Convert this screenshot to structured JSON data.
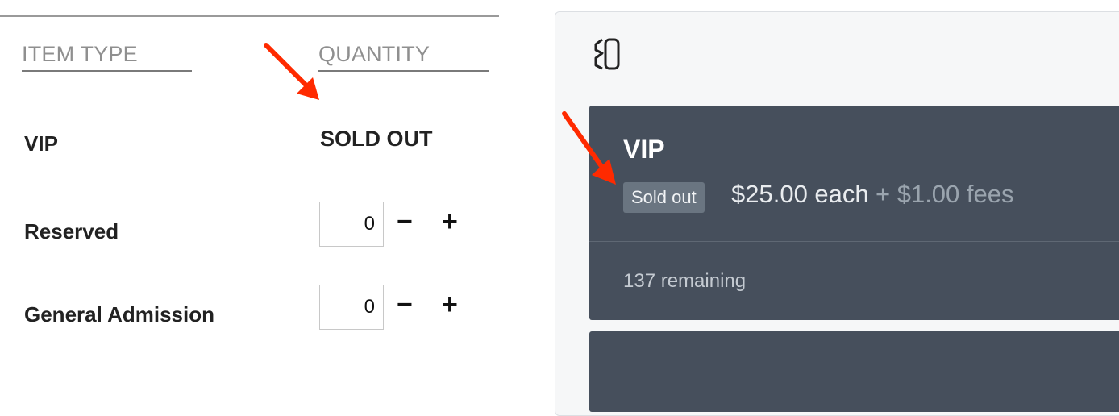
{
  "left_table": {
    "headers": {
      "item_type": "ITEM TYPE",
      "quantity": "QUANTITY"
    },
    "rows": [
      {
        "label": "VIP",
        "status": "SOLD OUT"
      },
      {
        "label": "Reserved",
        "quantity": "0",
        "minus": "−",
        "plus": "+"
      },
      {
        "label": "General Admission",
        "quantity": "0",
        "minus": "−",
        "plus": "+"
      }
    ]
  },
  "right_card": {
    "title": "VIP",
    "badge": "Sold out",
    "price": "$25.00 each",
    "fees": "+ $1.00 fees",
    "remaining": "137 remaining"
  },
  "icons": {
    "logo": "logo-icon",
    "arrow": "red-arrow-annotation"
  },
  "colors": {
    "card_bg": "#464f5c",
    "annotation_arrow": "#ff2a00",
    "badge_bg": "#6a7581"
  }
}
